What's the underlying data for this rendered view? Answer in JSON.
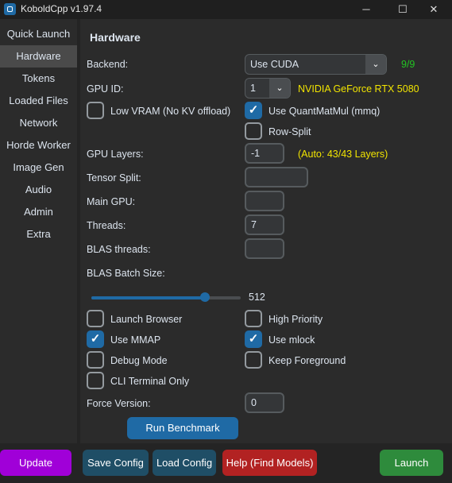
{
  "window": {
    "title": "KoboldCpp v1.97.4",
    "min_glyph": "─",
    "max_glyph": "☐",
    "close_glyph": "✕"
  },
  "sidebar": {
    "items": [
      "Quick Launch",
      "Hardware",
      "Tokens",
      "Loaded Files",
      "Network",
      "Horde Worker",
      "Image Gen",
      "Audio",
      "Admin",
      "Extra"
    ],
    "active": "Hardware"
  },
  "hardware": {
    "heading": "Hardware",
    "backend_label": "Backend:",
    "backend_value": "Use CUDA",
    "backend_count": "9/9",
    "gpu_id_label": "GPU ID:",
    "gpu_id_value": "1",
    "gpu_name": "NVIDIA GeForce RTX 5080",
    "low_vram_label": "Low VRAM (No KV offload)",
    "quantmatmul_label": "Use QuantMatMul (mmq)",
    "row_split_label": "Row-Split",
    "gpu_layers_label": "GPU Layers:",
    "gpu_layers_value": "-1",
    "gpu_layers_auto": "(Auto: 43/43 Layers)",
    "tensor_split_label": "Tensor Split:",
    "main_gpu_label": "Main GPU:",
    "threads_label": "Threads:",
    "threads_value": "7",
    "blas_threads_label": "BLAS threads:",
    "blas_batch_label": "BLAS Batch Size:",
    "blas_batch_value": "512",
    "blas_batch_fraction": 0.76,
    "launch_browser_label": "Launch Browser",
    "high_priority_label": "High Priority",
    "use_mmap_label": "Use MMAP",
    "use_mlock_label": "Use mlock",
    "debug_mode_label": "Debug Mode",
    "keep_foreground_label": "Keep Foreground",
    "cli_terminal_label": "CLI Terminal Only",
    "force_version_label": "Force Version:",
    "force_version_value": "0",
    "run_benchmark_label": "Run Benchmark",
    "checks": {
      "low_vram": false,
      "quantmatmul": true,
      "row_split": false,
      "launch_browser": false,
      "high_priority": false,
      "use_mmap": true,
      "use_mlock": true,
      "debug_mode": false,
      "keep_foreground": false,
      "cli_terminal": false
    }
  },
  "footer": {
    "update_label": "Update",
    "save_label": "Save Config",
    "load_label": "Load Config",
    "help_label": "Help (Find Models)",
    "launch_label": "Launch"
  },
  "colors": {
    "accent": "#1f6aa5",
    "update": "#a000d8",
    "save_load": "#1f4e66",
    "help": "#b22222",
    "launch": "#2e8b3c"
  }
}
